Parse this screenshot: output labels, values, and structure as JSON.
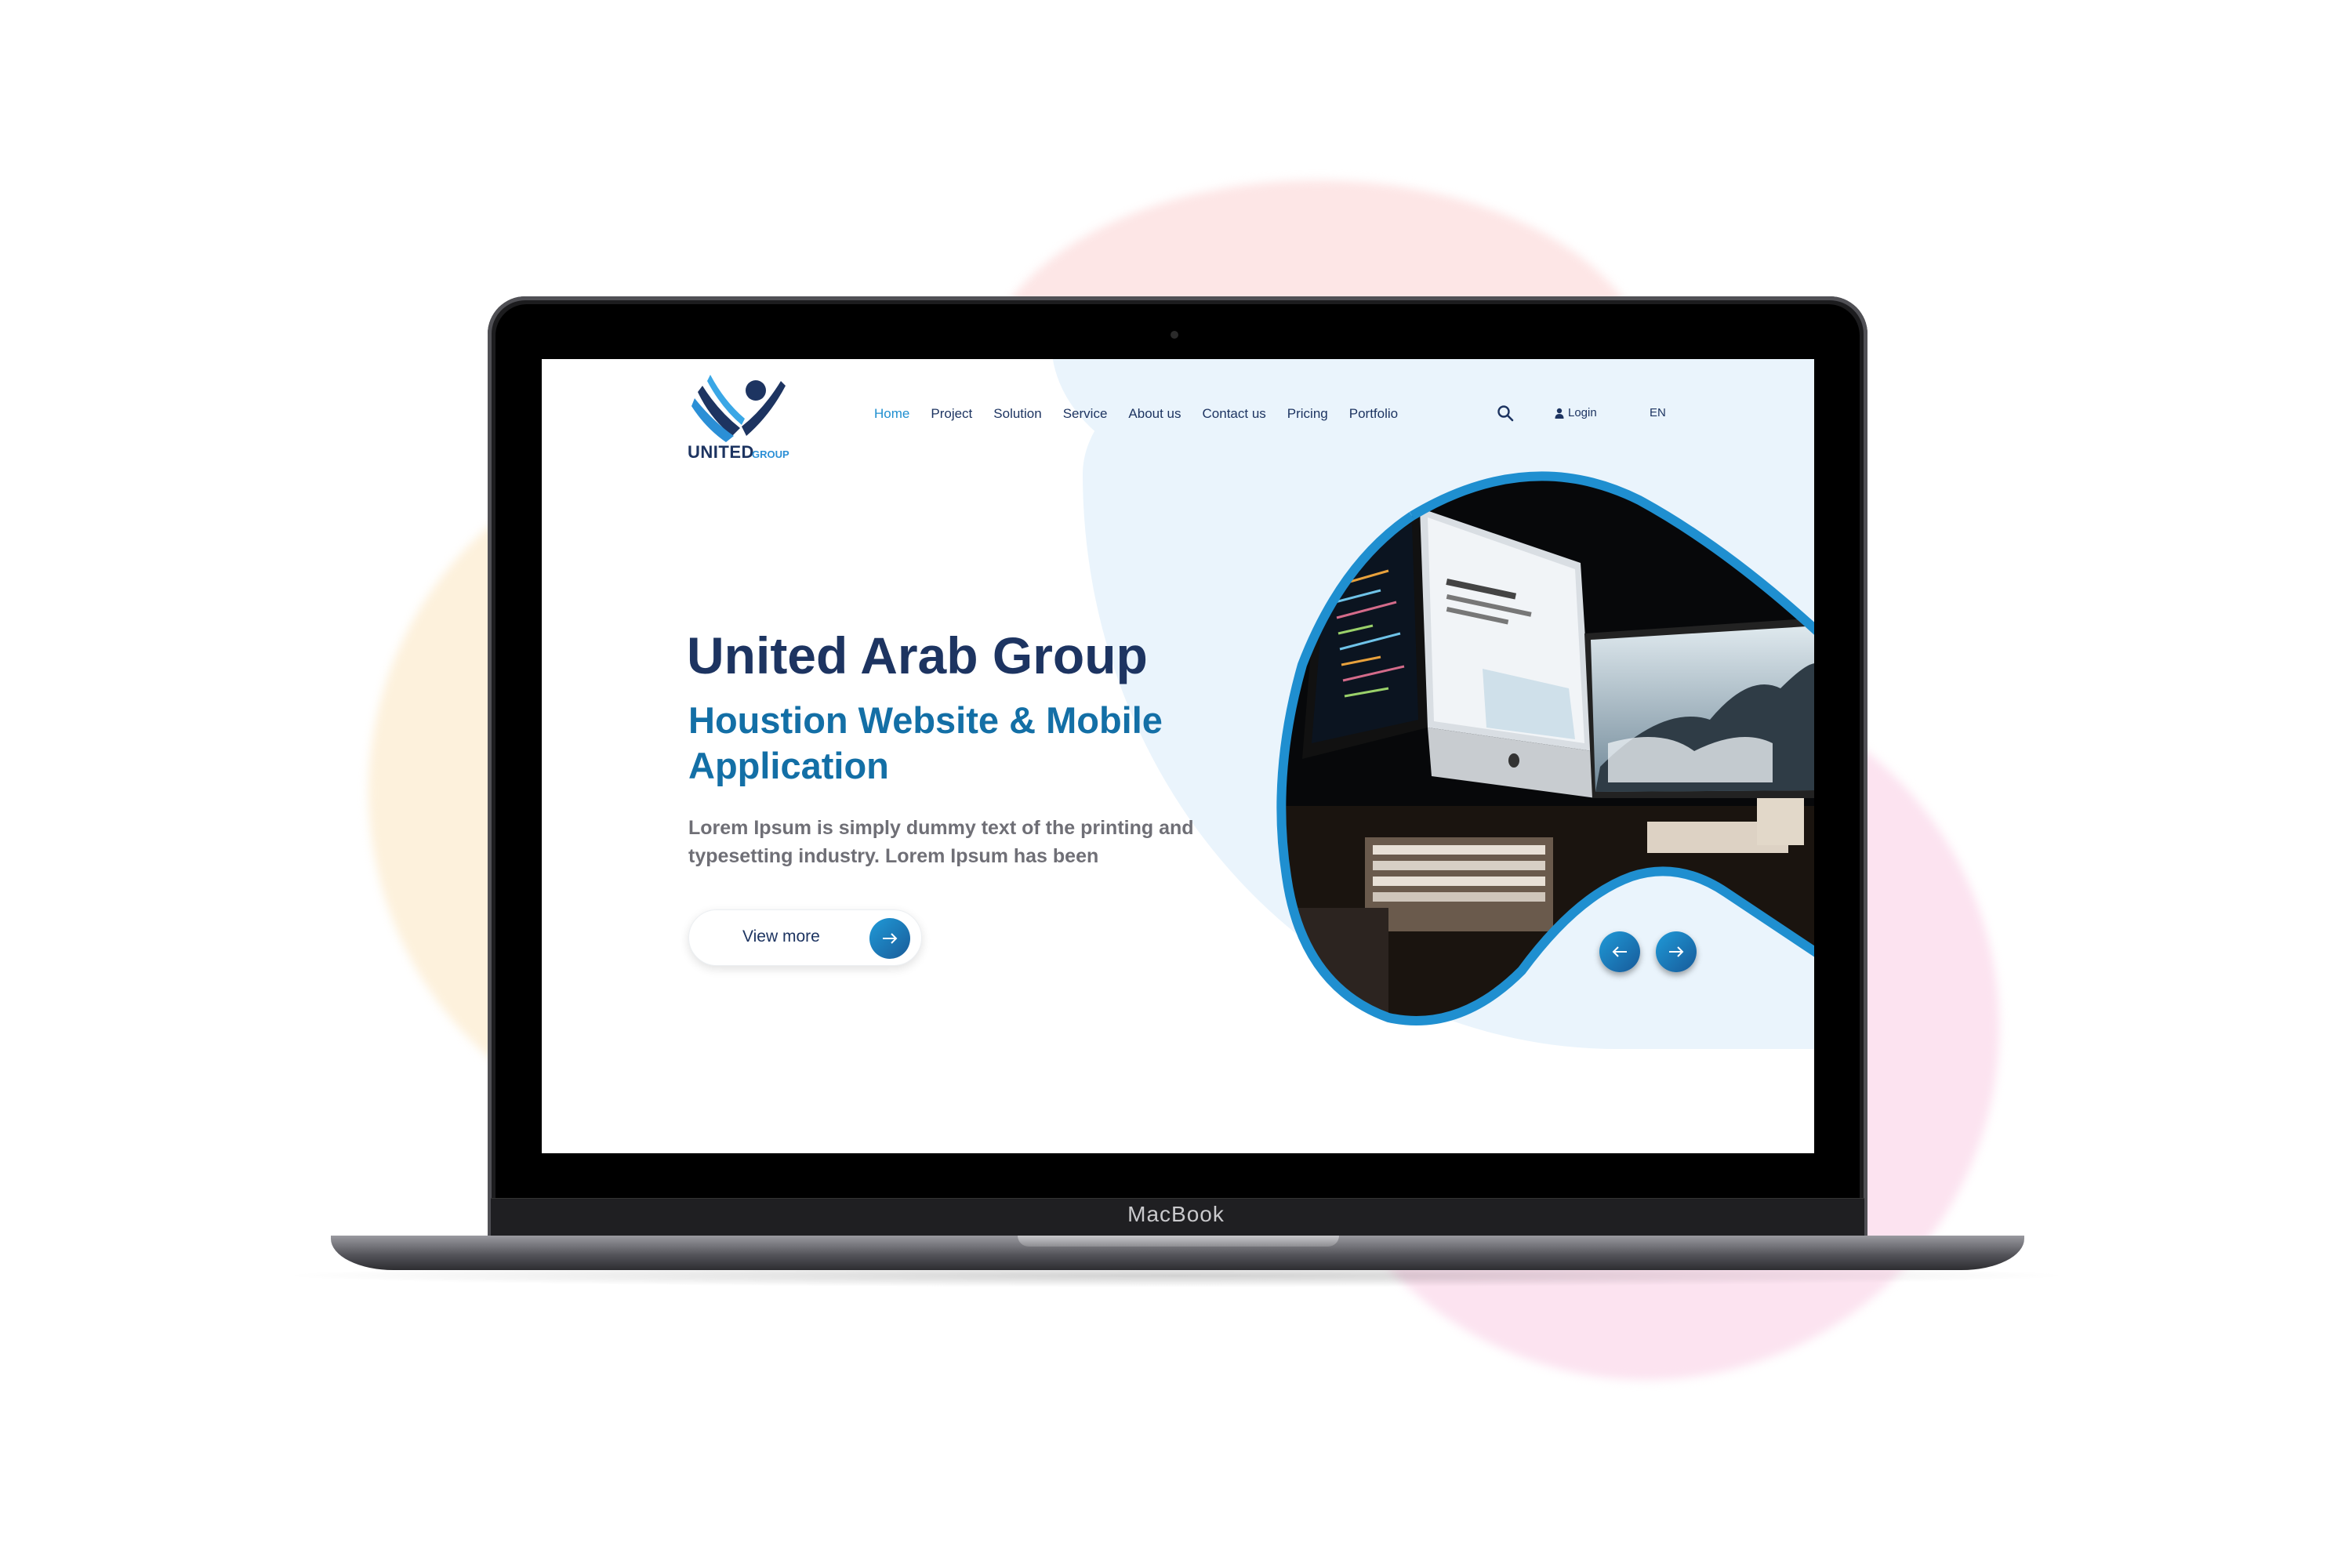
{
  "laptop": {
    "brand_label": "MacBook"
  },
  "site": {
    "logo": {
      "wordmark": "UNITED",
      "sub_wordmark": "GROUP"
    },
    "nav": [
      {
        "label": "Home",
        "active": true
      },
      {
        "label": "Project",
        "active": false
      },
      {
        "label": "Solution",
        "active": false
      },
      {
        "label": "Service",
        "active": false
      },
      {
        "label": "About us",
        "active": false
      },
      {
        "label": "Contact us",
        "active": false
      },
      {
        "label": "Pricing",
        "active": false
      },
      {
        "label": "Portfolio",
        "active": false
      }
    ],
    "search_icon": "search-icon",
    "login_label": "Login",
    "language": "EN",
    "hero": {
      "title": "United Arab Group",
      "subtitle": "Houstion Website & Mobile Application",
      "body": "Lorem Ipsum is simply dummy text of the printing and typesetting industry. Lorem Ipsum has been",
      "cta_label": "View more"
    },
    "colors": {
      "navy": "#1d3461",
      "accent_blue": "#1f8fd0",
      "subtitle_blue": "#136fa6",
      "body_gray": "#6f6f76",
      "panel_tint": "#eaf4fc"
    }
  }
}
